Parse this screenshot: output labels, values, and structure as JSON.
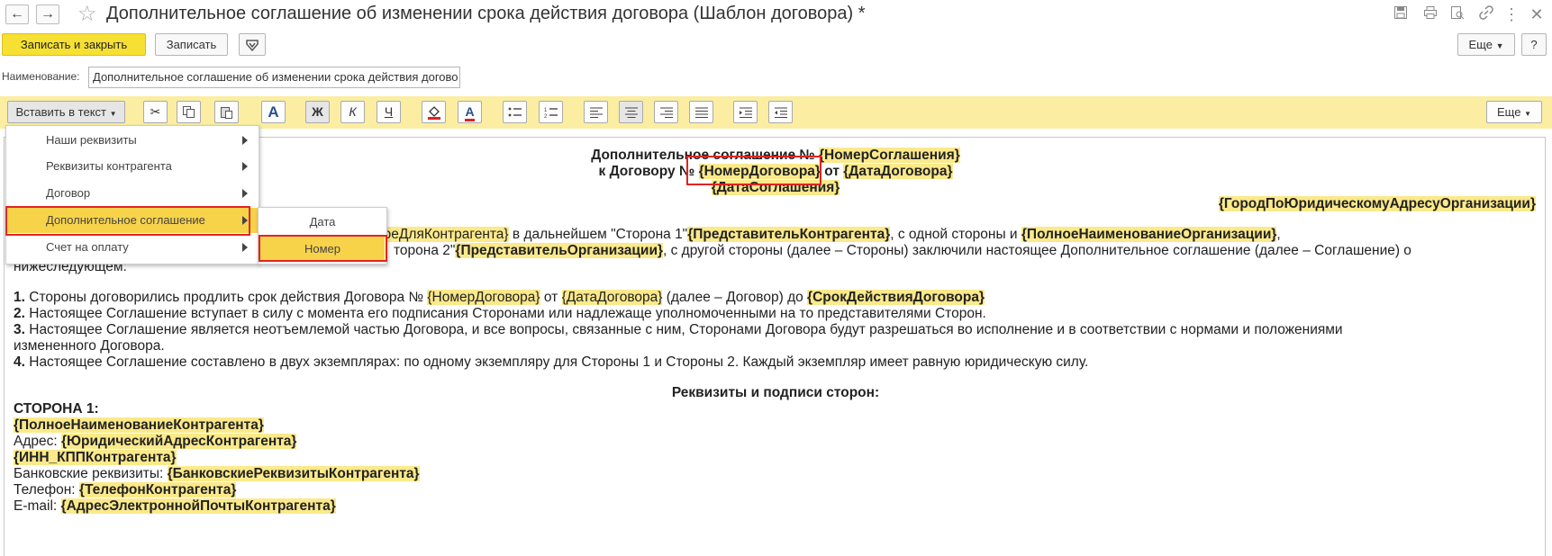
{
  "window": {
    "title": "Дополнительное соглашение об изменении срока действия договора (Шаблон договора) *",
    "back_icon": "←",
    "forward_icon": "→",
    "star_icon": "☆"
  },
  "commands": {
    "save_close": "Записать и закрыть",
    "save": "Записать",
    "more": "Еще",
    "help": "?"
  },
  "name_field": {
    "label": "Наименование:",
    "value": "Дополнительное соглашение об изменении срока действия догово"
  },
  "toolbar": {
    "insert_label": "Вставить в текст",
    "more": "Еще",
    "bold": "Ж",
    "italic": "К",
    "underline": "Ч",
    "font": "A",
    "font_color": "A"
  },
  "insert_menu": {
    "items": [
      "Наши реквизиты",
      "Реквизиты контрагента",
      "Договор",
      "Дополнительное соглашение",
      "Счет на оплату"
    ],
    "selected_index": 3,
    "submenu": [
      "Дата",
      "Номер"
    ],
    "submenu_selected_index": 1
  },
  "document": {
    "header1_text": "Дополнительное соглашение №",
    "header1_field": "{НомерСоглашения}",
    "header2_text": "к Договору №",
    "header2_field1": "{НомерДоговора}",
    "header2_mid": " от ",
    "header2_field2": "{ДатаДоговора}",
    "header3_field": "{ДатаСоглашения}",
    "city_field": "{ГородПоЮридическомуАдресуОрганизации}",
    "p1_frag1": "моеДляКонтрагента}",
    "p1_text1": " в дальнейшем \"Сторона 1\"",
    "p1_field2": "{ПредставительКонтрагента}",
    "p1_text2": ", с одной стороны и ",
    "p1_field3": "{ПолноеНаименованиеОрганизации}",
    "p1_text3": ",",
    "p2_text1": "торона 2\"",
    "p2_field1": "{ПредставительОрганизации}",
    "p2_text2": ", с другой стороны (далее – Стороны) заключили настоящее Дополнительное соглашение (далее – Соглашение) о",
    "p3_text": "нижеследующем:",
    "item1_num": "1.",
    "item1_text1": " Стороны договорились продлить срок действия Договора № ",
    "item1_field1": "{НомерДоговора}",
    "item1_text2": " от ",
    "item1_field2": "{ДатаДоговора}",
    "item1_text3": " (далее – Договор) до ",
    "item1_field3": "{СрокДействияДоговора}",
    "item2_num": "2.",
    "item2_text": " Настоящее Соглашение вступает в силу с момента его подписания Сторонами или надлежаще уполномоченными на то представителями Сторон.",
    "item3_num": "3.",
    "item3_text": " Настоящее Соглашение является неотъемлемой частью Договора, и все вопросы, связанные с ним, Сторонами Договора будут разрешаться во исполнение и в соответствии с нормами и положениями",
    "item3_cont": "измененного Договора.",
    "item4_num": "4.",
    "item4_text": " Настоящее Соглашение составлено в двух экземплярах: по одному экземпляру для Стороны 1 и Стороны 2. Каждый экземпляр имеет равную юридическую силу.",
    "requisites_title": "Реквизиты и подписи сторон:",
    "side1_title": "СТОРОНА 1:",
    "side1_name_field": "{ПолноеНаименованиеКонтрагента}",
    "address_label": "Адрес: ",
    "address_field": "{ЮридическийАдресКонтрагента}",
    "inn_field": "{ИНН_КППКонтрагента}",
    "bank_label": "Банковские реквизиты: ",
    "bank_field": "{БанковскиеРеквизитыКонтрагента}",
    "phone_label": "Телефон: ",
    "phone_field": "{ТелефонКонтрагента}",
    "email_label": "E-mail: ",
    "email_field": "{АдресЭлектроннойПочтыКонтрагента}"
  }
}
